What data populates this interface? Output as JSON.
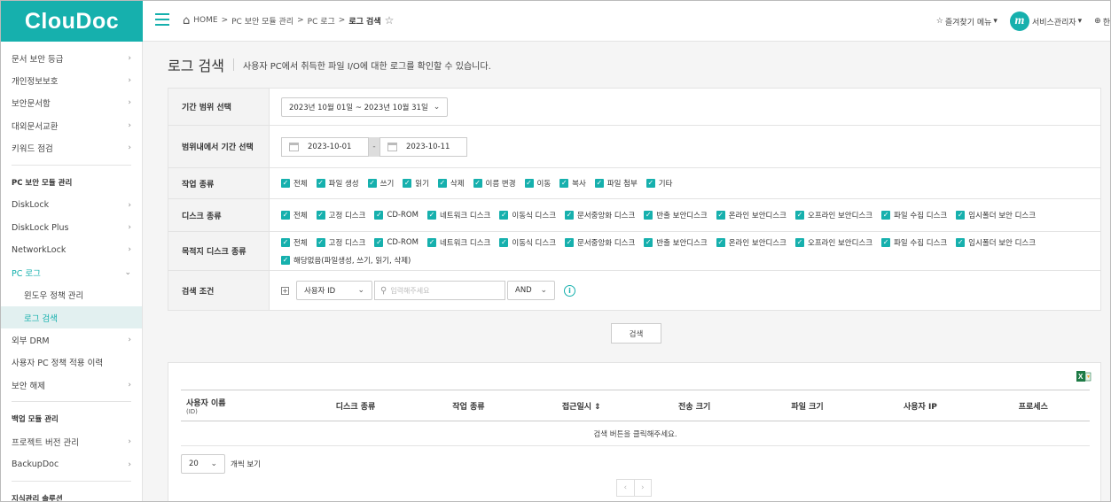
{
  "brand": {
    "logo": "ClouDoc",
    "accent": "#16b0ad"
  },
  "breadcrumb": {
    "home": "HOME",
    "sep": ">",
    "items": [
      "PC 보안 모듈 관리",
      "PC 로그"
    ],
    "current": "로그 검색"
  },
  "header": {
    "favorites": "즐겨찾기 메뉴",
    "avatar_letter": "m",
    "user": "서비스관리자",
    "lang": "한"
  },
  "sidebar": {
    "items": [
      {
        "label": "문서 보안 등급",
        "chev": "›"
      },
      {
        "label": "개인정보보호",
        "chev": "›"
      },
      {
        "label": "보안문서함",
        "chev": "›"
      },
      {
        "label": "대외문서교환",
        "chev": "›"
      },
      {
        "label": "키워드 점검",
        "chev": "›"
      }
    ],
    "section1": "PC 보안 모듈 관리",
    "items2": [
      {
        "label": "DiskLock",
        "chev": "›"
      },
      {
        "label": "DiskLock Plus",
        "chev": "›"
      },
      {
        "label": "NetworkLock",
        "chev": "›"
      },
      {
        "label": "PC 로그",
        "chev": "⌄"
      },
      {
        "label": "윈도우 정책 관리"
      },
      {
        "label": "로그 검색"
      },
      {
        "label": "외부 DRM",
        "chev": "›"
      },
      {
        "label": "사용자 PC 정책 적용 이력"
      },
      {
        "label": "보안 해제",
        "chev": "›"
      }
    ],
    "section2": "백업 모듈 관리",
    "items3": [
      {
        "label": "프로젝트 버전 관리",
        "chev": "›"
      },
      {
        "label": "BackupDoc",
        "chev": "›"
      }
    ],
    "section3": "지식관리 솔루션"
  },
  "page": {
    "title": "로그 검색",
    "desc": "사용자 PC에서 취득한 파일 I/O에 대한 로그를 확인할 수 있습니다."
  },
  "form": {
    "period_label": "기간 범위 선택",
    "period_value": "2023년 10월 01일 ~ 2023년 10월 31일",
    "range_label": "범위내에서 기간 선택",
    "date_from": "2023-10-01",
    "date_sep": "-",
    "date_to": "2023-10-11",
    "work_label": "작업 종류",
    "work_types": [
      "전체",
      "파일 생성",
      "쓰기",
      "읽기",
      "삭제",
      "이름 변경",
      "이동",
      "복사",
      "파일 첨부",
      "기타"
    ],
    "disk_label": "디스크 종류",
    "disk_types": [
      "전체",
      "고정 디스크",
      "CD-ROM",
      "네트워크 디스크",
      "이동식 디스크",
      "문서중앙화 디스크",
      "반출 보안디스크",
      "온라인 보안디스크",
      "오프라인 보안디스크",
      "파일 수집 디스크",
      "임시폴더 보안 디스크"
    ],
    "dest_label": "목적지 디스크 종류",
    "dest_types": [
      "전체",
      "고정 디스크",
      "CD-ROM",
      "네트워크 디스크",
      "이동식 디스크",
      "문서중앙화 디스크",
      "반출 보안디스크",
      "온라인 보안디스크",
      "오프라인 보안디스크",
      "파일 수집 디스크",
      "임시폴더 보안 디스크",
      "해당없음(파일생성, 쓰기, 읽기, 삭제)"
    ],
    "cond_label": "검색 조건",
    "cond_field": "사용자 ID",
    "cond_placeholder": "입력해주세요",
    "cond_op": "AND",
    "search_button": "검색"
  },
  "table": {
    "headers": [
      {
        "label": "사용자 이름",
        "sub": "(ID)"
      },
      {
        "label": "디스크 종류"
      },
      {
        "label": "작업 종류"
      },
      {
        "label": "접근일시 ⇕"
      },
      {
        "label": "전송 크기"
      },
      {
        "label": "파일 크기"
      },
      {
        "label": "사용자 IP"
      },
      {
        "label": "프로세스"
      }
    ],
    "empty": "검색 버튼을 클릭해주세요.",
    "per_page": "20",
    "per_page_label": "개씩 보기",
    "prev": "‹",
    "next": "›"
  }
}
